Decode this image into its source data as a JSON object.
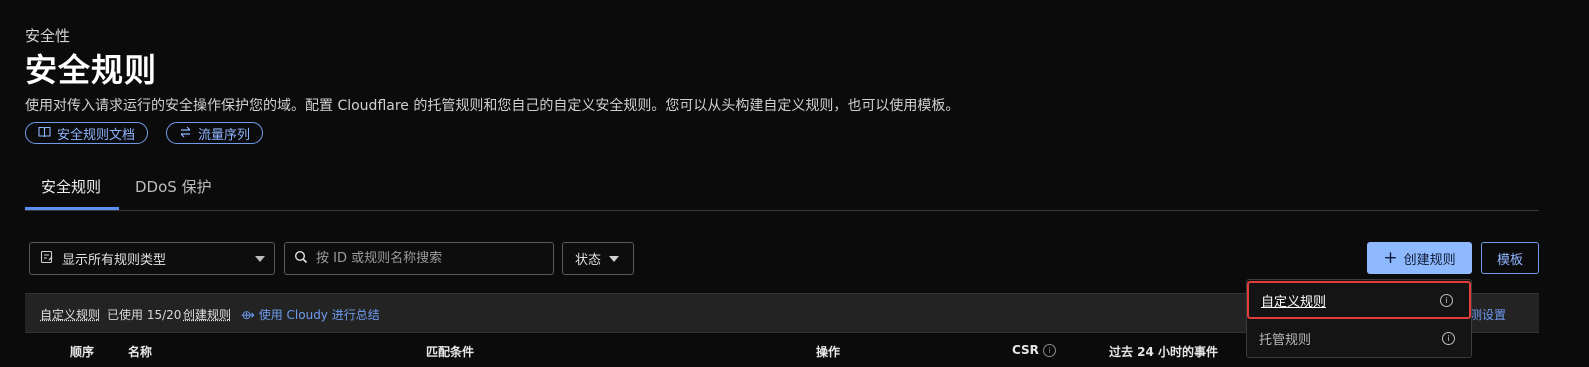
{
  "header": {
    "eyebrow": "安全性",
    "title": "安全规则",
    "description": "使用对传入请求运行的安全操作保护您的域。配置 Cloudflare 的托管规则和您自己的自定义安全规则。您可以从头构建自定义规则，也可以使用模板。",
    "docs_pill": "安全规则文档",
    "sequence_pill": "流量序列"
  },
  "tabs": [
    {
      "label": "安全规则",
      "active": true
    },
    {
      "label": "DDoS 保护",
      "active": false
    }
  ],
  "filters": {
    "rule_type_selected": "显示所有规则类型",
    "search_placeholder": "按 ID 或规则名称搜索",
    "status_label": "状态"
  },
  "actions": {
    "create_label": "创建规则",
    "template_label": "模板"
  },
  "section_bar": {
    "title": "自定义规则",
    "usage": "已使用 15/20",
    "create_link": "创建规则",
    "cloudy_link": "使用 Cloudy 进行总结",
    "right_link_partial": "检测设置"
  },
  "columns": [
    "顺序",
    "名称",
    "匹配条件",
    "操作",
    "CSR",
    "过去 24 小时的事件"
  ],
  "dropdown": {
    "items": [
      {
        "label": "自定义规则",
        "highlighted": true
      },
      {
        "label": "托管规则",
        "highlighted": false
      }
    ]
  },
  "colors": {
    "accent": "#8fb9ff",
    "highlight_border": "#e23c3c",
    "background": "#0b0b0b"
  }
}
